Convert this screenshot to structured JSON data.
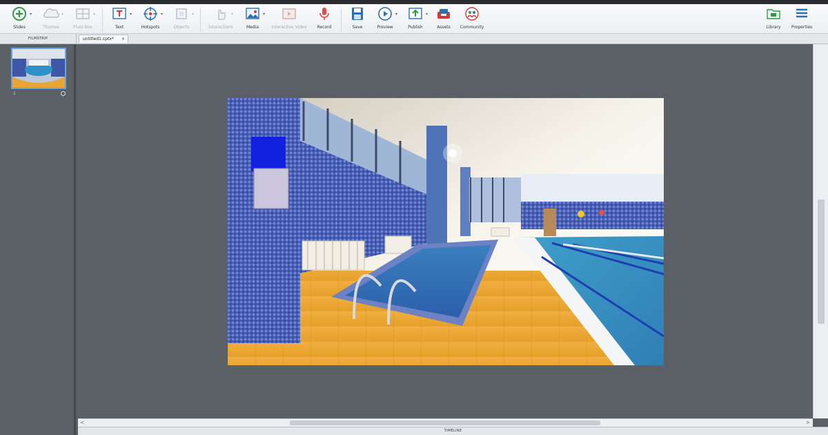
{
  "toolbar": {
    "slides": "Slides",
    "themes": "Themes",
    "fluid_box": "Fluid Box",
    "text": "Text",
    "hotspots": "Hotspots",
    "objects": "Objects",
    "interactions": "Interactions",
    "media": "Media",
    "interactive_video": "Interactive Video",
    "record": "Record",
    "save": "Save",
    "preview": "Preview",
    "publish": "Publish",
    "assets": "Assets",
    "community": "Community",
    "library": "Library",
    "properties": "Properties"
  },
  "filmstrip": {
    "title": "FILMSTRIP",
    "slide_number": "1"
  },
  "tabs": [
    {
      "label": "untitled1.cptx*",
      "close": "×"
    }
  ],
  "panels": {
    "timeline": "TIMELINE"
  },
  "scroll": {
    "left_arrow": "<",
    "right_arrow": ">"
  },
  "colors": {
    "stage": "#5b5f66",
    "selection": "#6da2e2",
    "record": "#e14b4b",
    "accent_blue": "#2d6fb5"
  }
}
